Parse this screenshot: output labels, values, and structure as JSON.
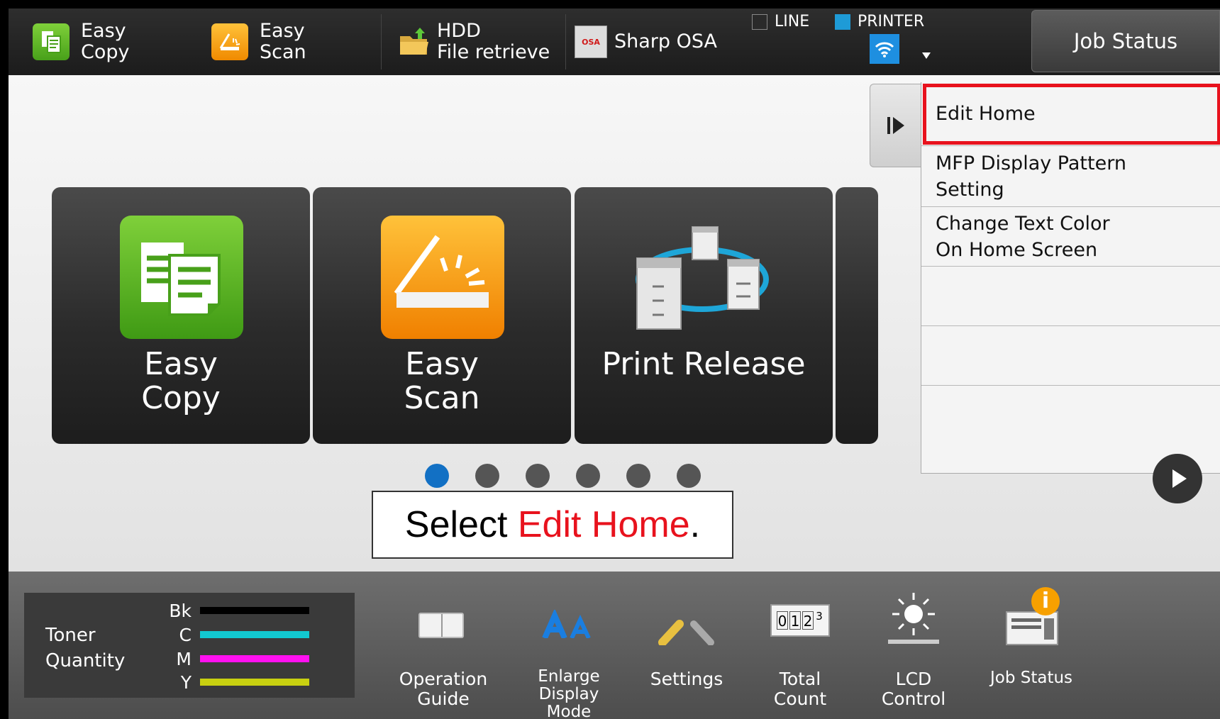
{
  "topbar": {
    "shortcuts": [
      {
        "label": "Easy\nCopy",
        "icon": "copy-icon"
      },
      {
        "label": "Easy\nScan",
        "icon": "scan-icon"
      },
      {
        "label": "HDD\nFile retrieve",
        "icon": "folder-upload-icon"
      },
      {
        "label": "Sharp OSA",
        "icon": "osa-icon",
        "icon_text": "OSA"
      }
    ],
    "indicators": {
      "line": "LINE",
      "printer": "PRINTER",
      "line_color": "#2a2a2a",
      "printer_color": "#1e9bd7"
    },
    "job_status": "Job Status"
  },
  "tiles": [
    {
      "label": "Easy\nCopy",
      "icon": "copy-icon"
    },
    {
      "label": "Easy\nScan",
      "icon": "scan-icon"
    },
    {
      "label": "Print Release",
      "icon": "print-release-icon"
    }
  ],
  "menu": {
    "items": [
      "Edit Home",
      "MFP Display Pattern\nSetting",
      "Change Text Color\nOn Home Screen",
      "",
      "",
      ""
    ],
    "highlighted_index": 0,
    "highlight_color": "#e8121d"
  },
  "pager": {
    "page_count": 6,
    "active_index": 0,
    "active_color": "#1270c4"
  },
  "toner": {
    "title": "Toner\nQuantity",
    "levels": [
      {
        "code": "Bk",
        "color": "#000000"
      },
      {
        "code": "C",
        "color": "#12c8d0"
      },
      {
        "code": "M",
        "color": "#ff10f0"
      },
      {
        "code": "Y",
        "color": "#c8d010"
      }
    ]
  },
  "bottom_items": [
    {
      "label": "Operation\nGuide",
      "icon": "book-icon"
    },
    {
      "label": "Enlarge\nDisplay\nMode",
      "icon": "enlarge-text-icon"
    },
    {
      "label": "Settings",
      "icon": "wrench-icon"
    },
    {
      "label": "Total\nCount",
      "icon": "counter-icon",
      "digits": [
        "0",
        "1",
        "2",
        "3"
      ]
    },
    {
      "label": "LCD\nControl",
      "icon": "brightness-icon"
    },
    {
      "label": "Job Status",
      "icon": "job-status-icon",
      "badge": "i"
    }
  ],
  "callout": {
    "prefix": "Select ",
    "highlight": "Edit Home",
    "suffix": "."
  }
}
